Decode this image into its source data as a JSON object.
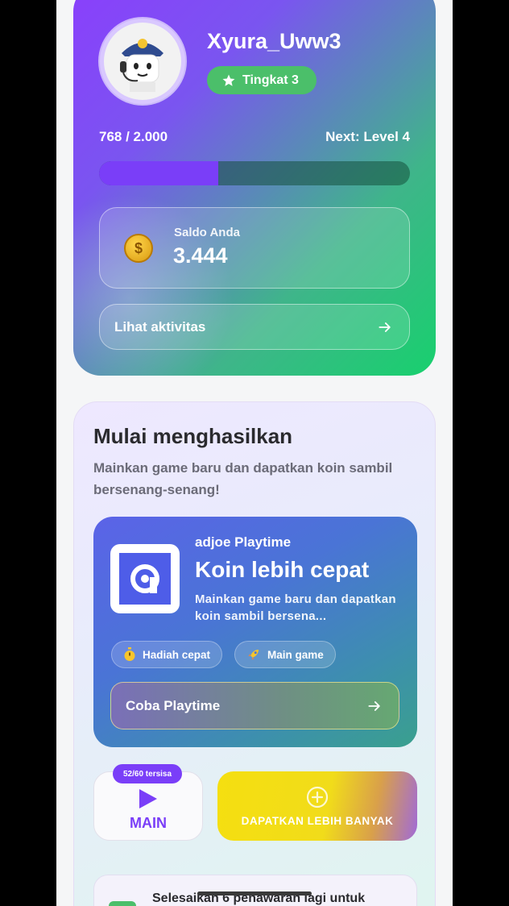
{
  "profile": {
    "username": "Xyura_Uww3",
    "level_badge": "Tingkat 3",
    "xp_text": "768 / 2.000",
    "next_level": "Next: Level 4",
    "xp_progress": 0.384,
    "balance_label": "Saldo Anda",
    "balance_value": "3.444",
    "activity_label": "Lihat aktivitas"
  },
  "earn": {
    "title": "Mulai menghasilkan",
    "description": "Mainkan game baru dan dapatkan koin sambil bersenang-senang!",
    "playtime": {
      "provider": "adjoe Playtime",
      "title": "Koin lebih cepat",
      "description": "Mainkan game baru dan dapatkan koin sambil bersena...",
      "chip_fast": "Hadiah cepat",
      "chip_play": "Main game",
      "try_label": "Coba Playtime"
    },
    "play_badge": "52/60 tersisa",
    "play_label": "MAIN",
    "earn_more_label": "DAPATKAN LEBIH BANYAK",
    "offers_text": "Selesaikan 6 penawaran lagi untuk"
  },
  "colors": {
    "accent_purple": "#7a3ef8",
    "accent_green": "#18d06e",
    "badge_green": "#4bbf6a",
    "earn_more_yellow": "#f5df10"
  },
  "icons": [
    "star-icon",
    "coin-icon",
    "arrow-right-icon",
    "app-logo-icon",
    "stopwatch-icon",
    "rocket-icon",
    "play-icon",
    "plus-circle-icon"
  ]
}
